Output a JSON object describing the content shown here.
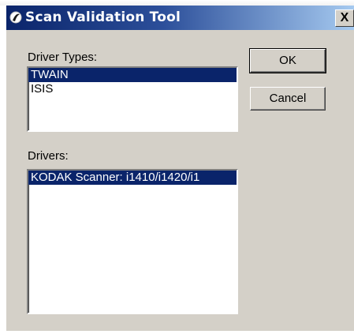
{
  "window": {
    "title": "Scan Validation Tool",
    "close_label": "X"
  },
  "driver_types": {
    "label": "Driver Types:",
    "items": [
      "TWAIN",
      "ISIS"
    ],
    "selected": "TWAIN"
  },
  "drivers": {
    "label": "Drivers:",
    "items": [
      "KODAK Scanner: i1410/i1420/i1"
    ],
    "selected": "KODAK Scanner: i1410/i1420/i1"
  },
  "buttons": {
    "ok_label": "OK",
    "cancel_label": "Cancel"
  },
  "colors": {
    "titlebar_start": "#0a246a",
    "titlebar_end": "#a6caf0",
    "selection": "#0a246a",
    "dialog_bg": "#d4d0c8"
  },
  "icons": {
    "app": "app-icon",
    "close": "close-icon"
  }
}
